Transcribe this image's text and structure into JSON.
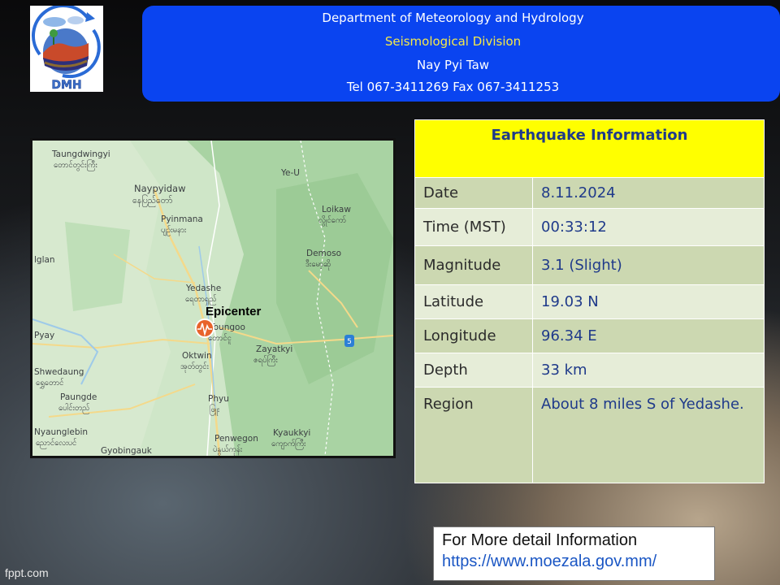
{
  "header": {
    "line1": "Department of Meteorology and Hydrology",
    "line2": "Seismological Division",
    "line3": "Nay Pyi Taw",
    "line4": "Tel 067-3411269 Fax 067-3411253"
  },
  "logo": {
    "text": "DMH"
  },
  "map": {
    "epicenter_label": "Epicenter",
    "places": [
      {
        "name": "Taungdwingyi",
        "local": "တောင်တွင်းကြီး"
      },
      {
        "name": "Naypyidaw",
        "local": "နေပြည်တော်"
      },
      {
        "name": "Pyinmana",
        "local": "ပျဉ်းမနား"
      },
      {
        "name": "Yedashe",
        "local": "ရေတာရှည်"
      },
      {
        "name": "Toungoo",
        "local": "တောင်ငူ"
      },
      {
        "name": "Oktwin",
        "local": "အုတ်တွင်း"
      },
      {
        "name": "Shwedaung",
        "local": "ရွှေတောင်"
      },
      {
        "name": "Paungde",
        "local": "ပေါင်းတည်"
      },
      {
        "name": "Nyaunglebin",
        "local": "ညောင်လေးပင်"
      },
      {
        "name": "Gyobingauk",
        "local": ""
      },
      {
        "name": "Phyu",
        "local": "ဖြူး"
      },
      {
        "name": "Zayatkyi",
        "local": "ဇရပ်ကြီး"
      },
      {
        "name": "Penwegon",
        "local": "ပဲနွယ်ကုန်း"
      },
      {
        "name": "Kyaukkyi",
        "local": "ကျောက်ကြီး"
      },
      {
        "name": "Loikaw",
        "local": "လွိုင်ကော်"
      },
      {
        "name": "Demoso",
        "local": "ဒီးမော့ဆို"
      },
      {
        "name": "Ye-U",
        "local": ""
      },
      {
        "name": "Pyay",
        "local": ""
      },
      {
        "name": "lglan",
        "local": ""
      }
    ],
    "road_badge": "5"
  },
  "table": {
    "title": "Earthquake Information",
    "rows": [
      {
        "label": "Date",
        "value": "8.11.2024"
      },
      {
        "label": "Time (MST)",
        "value": "00:33:12"
      },
      {
        "label": "Magnitude",
        "value": "3.1 (Slight)"
      },
      {
        "label": "Latitude",
        "value": "19.03 N"
      },
      {
        "label": "Longitude",
        "value": "96.34 E"
      },
      {
        "label": "Depth",
        "value": "33 km"
      },
      {
        "label": "Region",
        "value": "About 8 miles S of Yedashe."
      }
    ]
  },
  "more_info": {
    "line1": "For More detail Information",
    "url": "https://www.moezala.gov.mm/"
  },
  "footer": {
    "mark": "fppt.com"
  },
  "colors": {
    "banner_blue": "#0a44f0",
    "banner_subtitle": "#f5e94a",
    "table_header": "#ffff00",
    "row_dark": "#ccd8b1",
    "row_light": "#e6edd8",
    "value_text": "#1f3a8a",
    "epicenter_marker": "#e8632b"
  }
}
